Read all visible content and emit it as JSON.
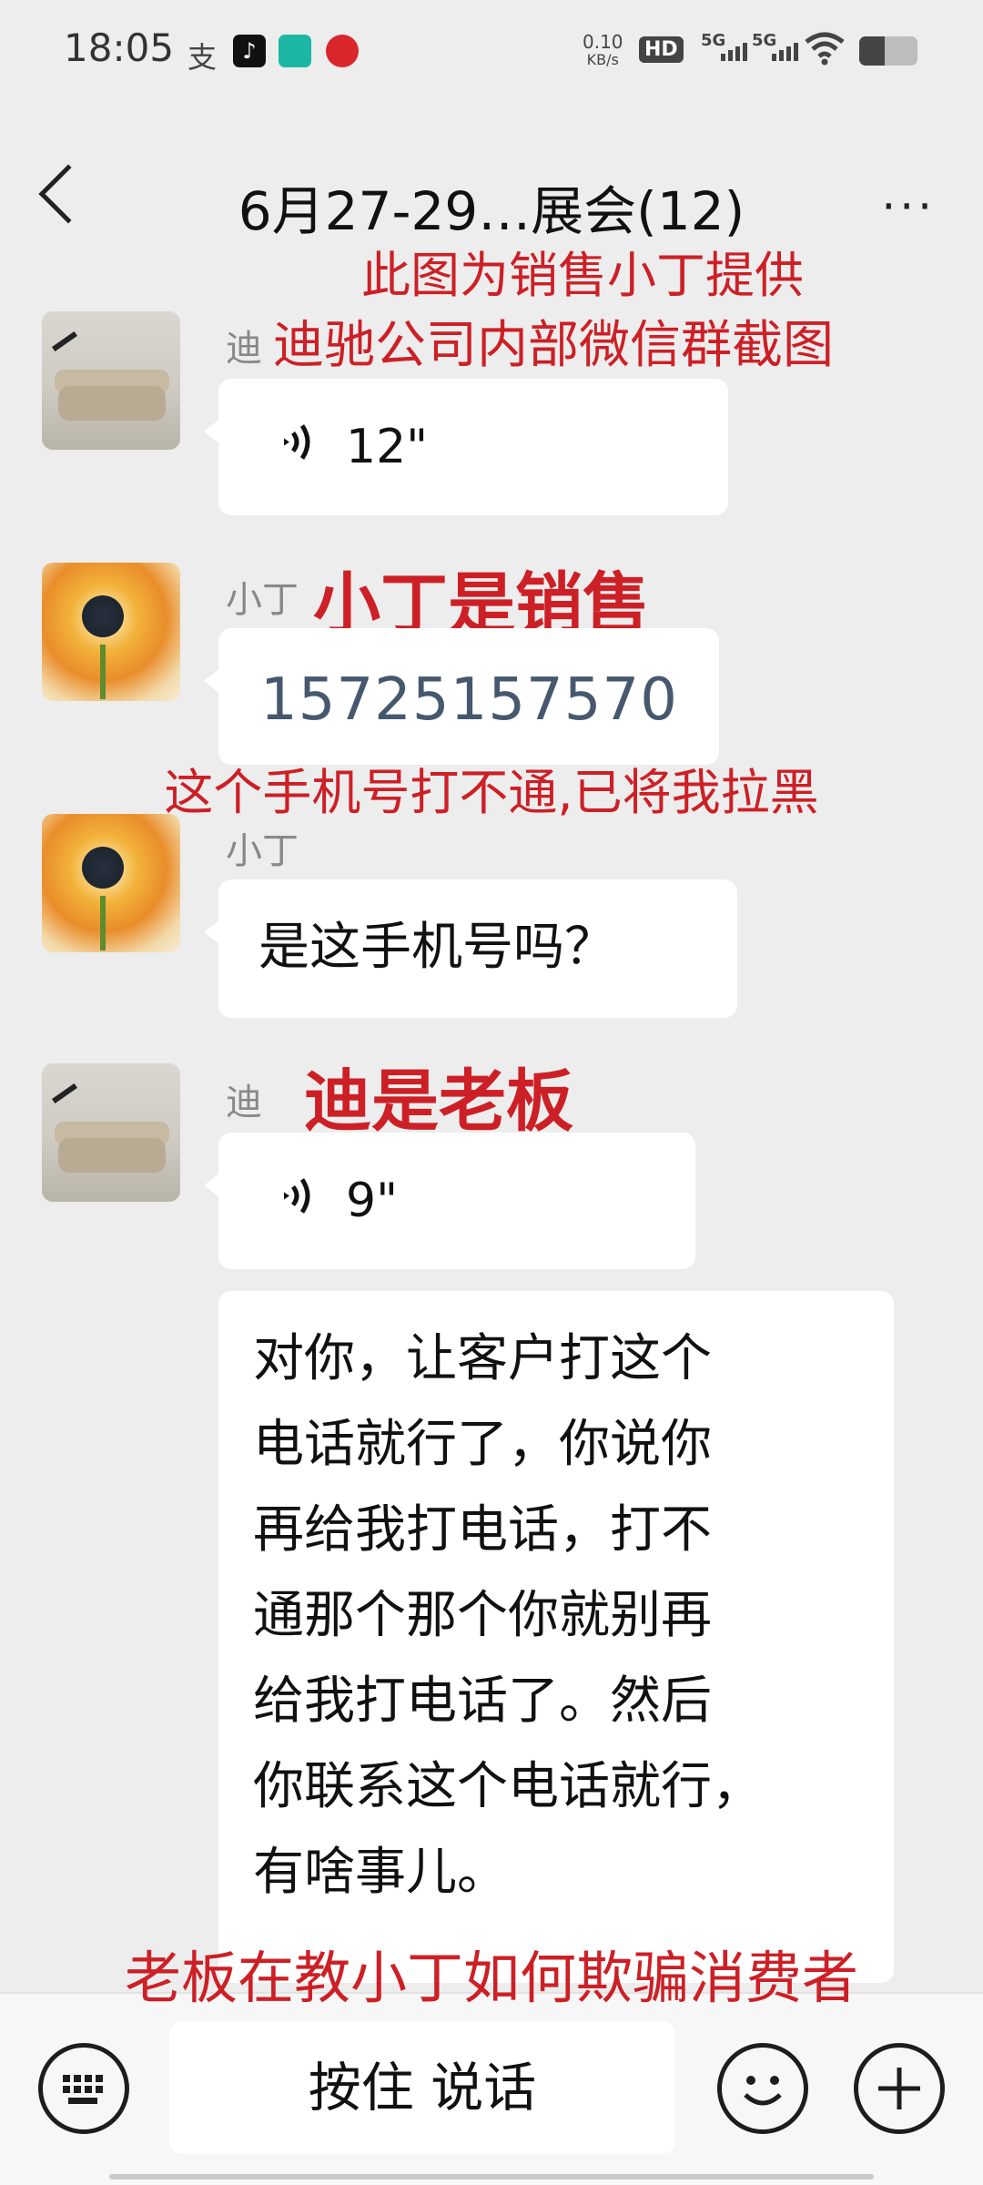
{
  "status_bar": {
    "time": "18:05",
    "net_speed_top": "0.10",
    "net_speed_bottom": "KB/s",
    "hd": "HD",
    "sig1": "5G",
    "sig2": "5G"
  },
  "header": {
    "title": "6月27-29…展会(12)"
  },
  "overlays": {
    "line1": "此图为销售小丁提供",
    "line2": "迪驰公司内部微信群截图",
    "sales_note": "小丁是销售",
    "phone_note": "这个手机号打不通,已将我拉黑",
    "boss_note": "迪是老板",
    "bottom_note": "老板在教小丁如何欺骗消费者"
  },
  "messages": [
    {
      "sender": "迪",
      "type": "voice",
      "duration": "12\""
    },
    {
      "sender": "小丁",
      "type": "text",
      "text": "15725157570"
    },
    {
      "sender": "小丁",
      "type": "text",
      "text": "是这手机号吗？"
    },
    {
      "sender": "迪",
      "type": "voice",
      "duration": "9\""
    },
    {
      "sender": "迪",
      "type": "text",
      "lines": [
        "对你，让客户打这个",
        "电话就行了，你说你",
        "再给我打电话，打不",
        "通那个那个你就别再",
        "给我打电话了。然后",
        "你联系这个电话就行，",
        "有啥事儿。"
      ]
    }
  ],
  "input_bar": {
    "hold_to_talk": "按住 说话"
  },
  "colors": {
    "background": "#ededed",
    "overlay_red": "#cc2026",
    "phone_link": "#46586e"
  }
}
